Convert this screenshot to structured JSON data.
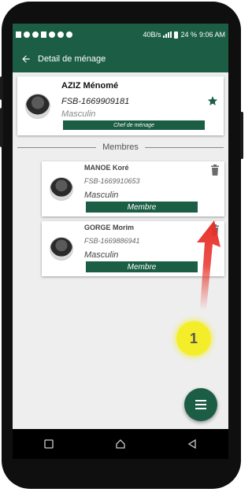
{
  "status_bar": {
    "network_speed": "40B/s",
    "battery": "24 %",
    "time": "9:06 AM"
  },
  "app_bar": {
    "title": "Detail de ménage",
    "back_icon": "arrow-left-icon"
  },
  "head_of_household": {
    "name": "AZIZ Ménomé",
    "id": "FSB-1669909181",
    "gender": "Masculin",
    "role": "Chef de ménage",
    "star_icon": "star-icon"
  },
  "members_divider": "Membres",
  "members": [
    {
      "name": "MANOE Koré",
      "id": "FSB-1669910653",
      "gender": "Masculin",
      "role": "Membre"
    },
    {
      "name": "GORGE Morim",
      "id": "FSB-1669886941",
      "gender": "Masculin",
      "role": "Membre"
    }
  ],
  "annotation": {
    "step": "1"
  },
  "fab": {
    "icon": "menu-icon"
  },
  "colors": {
    "primary": "#1b5e45",
    "annotation_arrow": "#e8312a",
    "annotation_badge": "#f4ee2a"
  }
}
